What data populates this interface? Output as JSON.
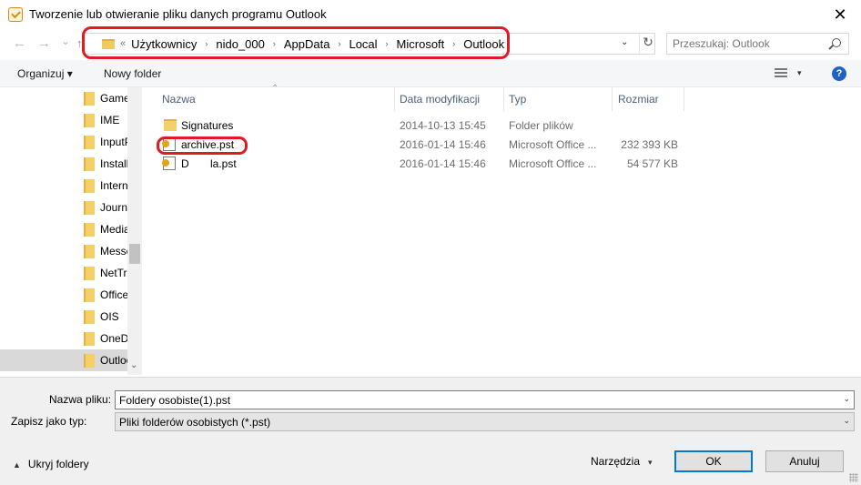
{
  "window": {
    "title": "Tworzenie lub otwieranie pliku danych programu Outlook",
    "close_glyph": "✕"
  },
  "nav": {
    "back_glyph": "←",
    "forward_glyph": "→",
    "recent_glyph": "⌄",
    "up_glyph": "↑"
  },
  "address": {
    "prefix": "«",
    "crumbs": [
      "Użytkownicy",
      "nido_000",
      "AppData",
      "Local",
      "Microsoft",
      "Outlook"
    ],
    "separator": "›",
    "dropdown_glyph": "⌄",
    "refresh_glyph": "↻"
  },
  "search": {
    "placeholder": "Przeszukaj: Outlook"
  },
  "toolbar": {
    "organize_label": "Organizuj ▾",
    "new_folder_label": "Nowy folder",
    "view_caret": "▾",
    "help_label": "?"
  },
  "nav_pane": {
    "items": [
      {
        "label": "Games"
      },
      {
        "label": "IME"
      },
      {
        "label": "InputPersonalization"
      },
      {
        "label": "Installer"
      },
      {
        "label": "Internet Explorer"
      },
      {
        "label": "Journal"
      },
      {
        "label": "Media Player"
      },
      {
        "label": "Messenger"
      },
      {
        "label": "NetTraffic"
      },
      {
        "label": "Office"
      },
      {
        "label": "OIS"
      },
      {
        "label": "OneDrive"
      },
      {
        "label": "Outlook"
      }
    ],
    "scroll_down_glyph": "⌄"
  },
  "file_list": {
    "columns": {
      "name": "Nazwa",
      "modified": "Data modyfikacji",
      "type": "Typ",
      "size": "Rozmiar"
    },
    "sort_caret": "⌃",
    "rows": [
      {
        "name": "Signatures",
        "modified": "2014-10-13 15:45",
        "type": "Folder plików",
        "size": "",
        "icon": "folder-icon"
      },
      {
        "name": "archive.pst",
        "modified": "2016-01-14 15:46",
        "type": "Microsoft Office ...",
        "size": "232 393 KB",
        "icon": "pst-file-icon"
      },
      {
        "name": "D       la.pst",
        "modified": "2016-01-14 15:46",
        "type": "Microsoft Office ...",
        "size": "54 577 KB",
        "icon": "pst-file-icon"
      }
    ]
  },
  "form": {
    "filename_label": "Nazwa pliku:",
    "filename_value": "Foldery osobiste(1).pst",
    "filetype_label_a": "Zapisz jako ",
    "filetype_label_b": "typ:",
    "filetype_value": "Pliki folderów osobistych (*.pst)",
    "dropdown_glyph": "⌄"
  },
  "footer": {
    "hide_folders_label": "Ukryj foldery",
    "hide_caret": "▲",
    "tools_label": "Narzędzia",
    "tools_caret": "▾",
    "ok_label": "OK",
    "cancel_label": "Anuluj"
  },
  "colors": {
    "annotation_red": "#e01b24",
    "accent_blue": "#0078d7"
  }
}
